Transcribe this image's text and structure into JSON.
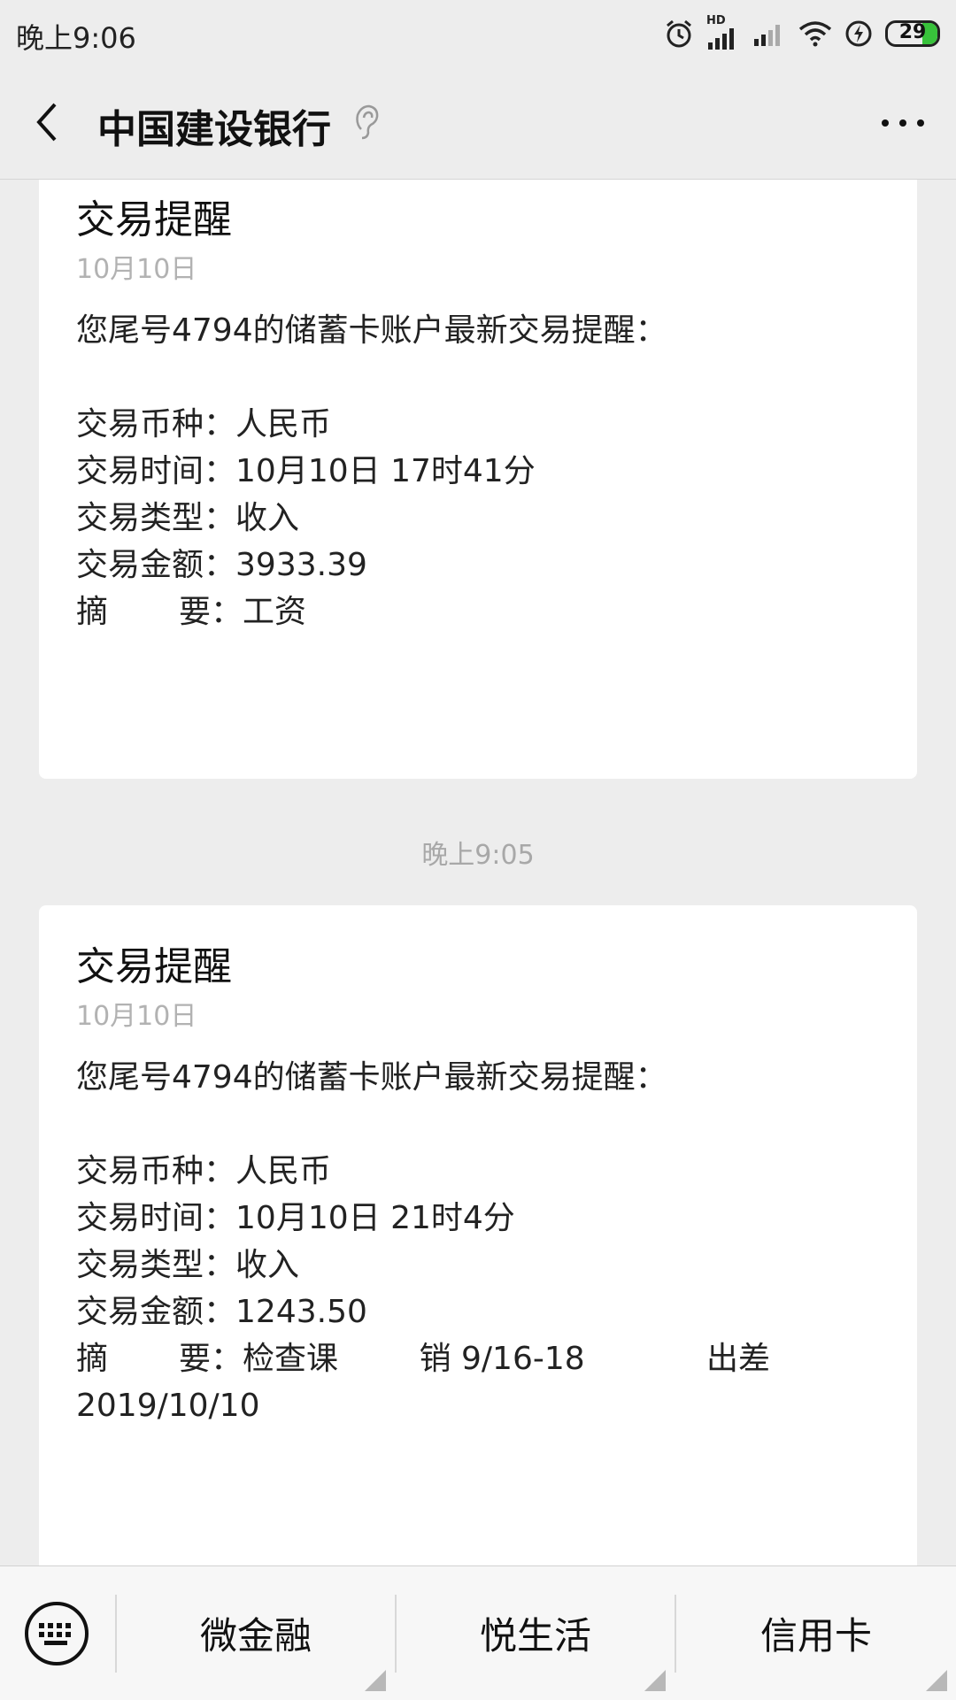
{
  "status_bar": {
    "time": "晚上9:06",
    "network_badge": "HD",
    "battery_level": "29",
    "icons": [
      "alarm-icon",
      "signal-hd-icon",
      "signal-icon",
      "wifi-icon",
      "charging-icon",
      "battery-icon"
    ]
  },
  "header": {
    "title": "中国建设银行",
    "icons": [
      "back-icon",
      "ear-icon",
      "more-icon"
    ]
  },
  "messages": [
    {
      "title": "交易提醒",
      "date": "10月10日",
      "intro": "您尾号4794的储蓄卡账户最新交易提醒：",
      "fields": [
        {
          "label": "交易币种：",
          "value": "人民币"
        },
        {
          "label": "交易时间：",
          "value": "10月10日 17时41分"
        },
        {
          "label": "交易类型：",
          "value": "收入"
        },
        {
          "label": "交易金额：",
          "value": "3933.39"
        }
      ],
      "summary": {
        "label_a": "摘",
        "label_b": "要：",
        "value": "工资"
      }
    },
    {
      "title": "交易提醒",
      "date": "10月10日",
      "intro": "您尾号4794的储蓄卡账户最新交易提醒：",
      "fields": [
        {
          "label": "交易币种：",
          "value": "人民币"
        },
        {
          "label": "交易时间：",
          "value": "10月10日 21时4分"
        },
        {
          "label": "交易类型：",
          "value": "收入"
        },
        {
          "label": "交易金额：",
          "value": "1243.50"
        }
      ],
      "summary": {
        "label_a": "摘",
        "label_b": "要：",
        "value": "检查课        销 9/16-18            出差",
        "value_line2": "2019/10/10"
      }
    }
  ],
  "time_separator": "晚上9:05",
  "bottom_menu": {
    "keyboard_icon": "keyboard-icon",
    "items": [
      {
        "label": "微金融"
      },
      {
        "label": "悦生活"
      },
      {
        "label": "信用卡"
      }
    ]
  },
  "colors": {
    "background": "#ededed",
    "card": "#ffffff",
    "muted_text": "#b2b2b2",
    "battery_green": "#38c23b"
  }
}
